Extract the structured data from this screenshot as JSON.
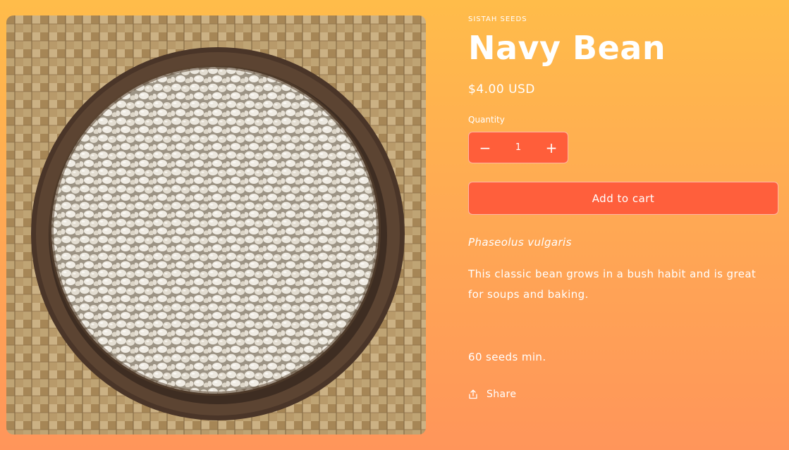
{
  "product": {
    "vendor": "SISTAH SEEDS",
    "title": "Navy Bean",
    "price": "$4.00 USD",
    "image_icon": "navy-bean-bowl-photo",
    "quantity": {
      "label": "Quantity",
      "value": "1",
      "decrease_symbol": "−",
      "increase_symbol": "+"
    },
    "add_to_cart_label": "Add to cart",
    "scientific_name": "Phaseolus vulgaris",
    "description": "This classic bean grows in a bush habit and is great for soups and baking.",
    "seed_count": "60 seeds min.",
    "share_label": "Share",
    "share_icon": "share-icon"
  },
  "colors": {
    "background_top": "#ffbc4a",
    "background_bottom": "#ff955a",
    "button": "#ff5f3c",
    "text": "#ffffff"
  }
}
